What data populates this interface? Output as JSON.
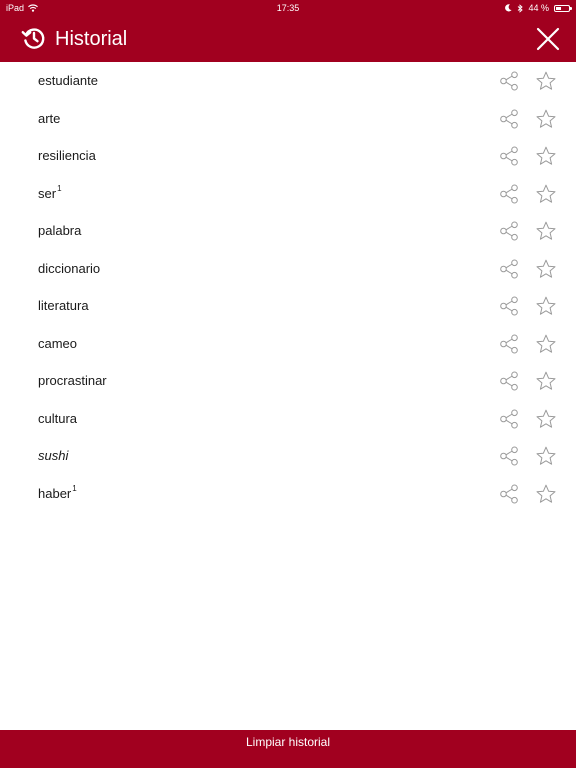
{
  "status_bar": {
    "device": "iPad",
    "time": "17:35",
    "battery_text": "44 %",
    "battery_level": 0.44
  },
  "header": {
    "title": "Historial",
    "icons": {
      "history": "history-icon",
      "close": "close-icon"
    }
  },
  "history": {
    "items": [
      {
        "word": "estudiante",
        "superscript": "",
        "italic": false
      },
      {
        "word": "arte",
        "superscript": "",
        "italic": false
      },
      {
        "word": "resiliencia",
        "superscript": "",
        "italic": false
      },
      {
        "word": "ser",
        "superscript": "1",
        "italic": false
      },
      {
        "word": "palabra",
        "superscript": "",
        "italic": false
      },
      {
        "word": "diccionario",
        "superscript": "",
        "italic": false
      },
      {
        "word": "literatura",
        "superscript": "",
        "italic": false
      },
      {
        "word": "cameo",
        "superscript": "",
        "italic": false
      },
      {
        "word": "procrastinar",
        "superscript": "",
        "italic": false
      },
      {
        "word": "cultura",
        "superscript": "",
        "italic": false
      },
      {
        "word": "sushi",
        "superscript": "",
        "italic": true
      },
      {
        "word": "haber",
        "superscript": "1",
        "italic": false
      }
    ],
    "row_icons": {
      "share": "share-icon",
      "favorite": "star-icon"
    }
  },
  "footer": {
    "clear_label": "Limpiar historial"
  },
  "colors": {
    "brand_red": "#a1001f",
    "icon_gray": "#8e8e8e",
    "text": "#1a1a1a",
    "background": "#ffffff"
  }
}
